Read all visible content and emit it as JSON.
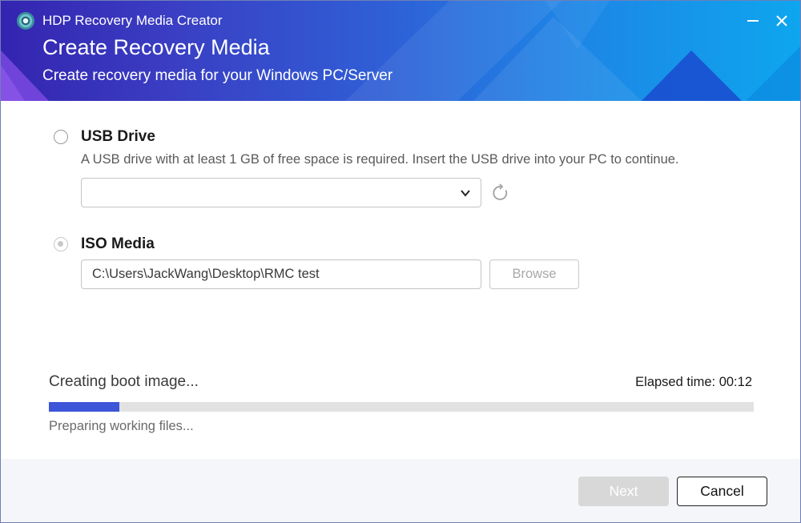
{
  "window": {
    "app_title": "HDP Recovery Media Creator",
    "minimize_icon": "minimize-icon",
    "close_icon": "close-icon"
  },
  "header": {
    "title": "Create Recovery Media",
    "subtitle": "Create recovery media for your Windows PC/Server"
  },
  "options": {
    "usb": {
      "label": "USB Drive",
      "description": "A USB drive with at least 1 GB of free space is required. Insert the USB drive into your PC to continue.",
      "selected": false,
      "dropdown_value": "",
      "refresh_icon": "refresh-icon"
    },
    "iso": {
      "label": "ISO Media",
      "selected": true,
      "path_value": "C:\\Users\\JackWang\\Desktop\\RMC test",
      "browse_label": "Browse"
    }
  },
  "progress": {
    "status": "Creating boot image...",
    "elapsed": "Elapsed time: 00:12",
    "percent": 10,
    "detail": "Preparing working files..."
  },
  "footer": {
    "next_label": "Next",
    "cancel_label": "Cancel"
  },
  "colors": {
    "accent": "#3d55d8",
    "header_start": "#3424b0",
    "header_end": "#0ea6ee"
  }
}
